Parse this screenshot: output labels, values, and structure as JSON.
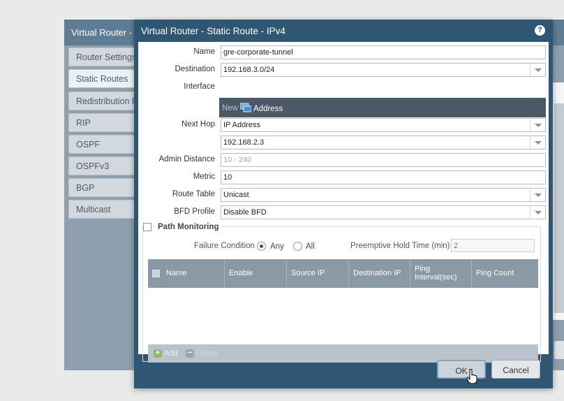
{
  "background": {
    "title": "Virtual Router - d",
    "nav": [
      {
        "label": "Router Settings"
      },
      {
        "label": "Static Routes"
      },
      {
        "label": "Redistribution Pr"
      },
      {
        "label": "RIP"
      },
      {
        "label": "OSPF"
      },
      {
        "label": "OSPFv3"
      },
      {
        "label": "BGP"
      },
      {
        "label": "Multicast"
      }
    ],
    "active_nav": "Static Routes"
  },
  "dialog": {
    "title": "Virtual Router - Static Route - IPv4",
    "help_icon": "?",
    "fields": {
      "name_label": "Name",
      "name_value": "gre-corporate-tunnel",
      "destination_label": "Destination",
      "destination_value": "192.168.3.0/24",
      "interface_label": "Interface",
      "next_hop_label": "Next Hop",
      "next_hop_value": "IP Address",
      "next_hop_ip_value": "192.168.2.3",
      "admin_distance_label": "Admin Distance",
      "admin_distance_placeholder": "10 - 240",
      "metric_label": "Metric",
      "metric_value": "10",
      "route_table_label": "Route Table",
      "route_table_value": "Unicast",
      "bfd_profile_label": "BFD Profile",
      "bfd_profile_value": "Disable BFD"
    },
    "interface_dropdown": {
      "new_label": "New",
      "address_label": "Address"
    },
    "path_monitoring": {
      "label": "Path Monitoring",
      "checked": false,
      "failure_condition_label": "Failure Condition",
      "options": [
        "Any",
        "All"
      ],
      "selected": "Any",
      "preemptive_hold_label": "Preemptive Hold Time (min)",
      "preemptive_hold_value": "2",
      "columns": [
        "Name",
        "Enable",
        "Source IP",
        "Destination IP",
        "Ping Interval(sec)",
        "Ping Count"
      ],
      "rows": [],
      "add_label": "Add",
      "delete_label": "Delete"
    },
    "buttons": {
      "ok": "OK",
      "cancel": "Cancel"
    }
  },
  "colors": {
    "dialog_frame": "#2f5673",
    "grid_header": "#8b98a5",
    "dropdown_bg": "#4b5866"
  }
}
